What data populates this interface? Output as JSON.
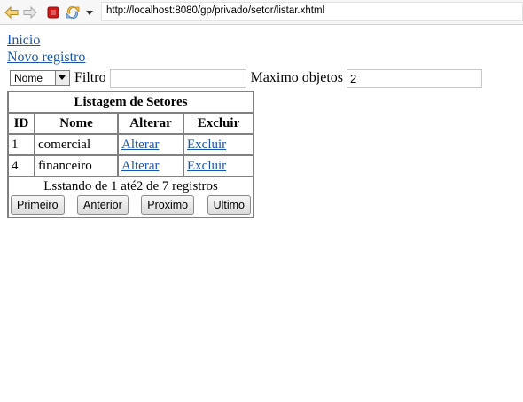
{
  "browser": {
    "url": "http://localhost:8080/gp/privado/setor/listar.xhtml",
    "icons": [
      "back-arrow-icon",
      "forward-arrow-icon",
      "stop-icon",
      "reload-icon",
      "dropdown-caret-icon"
    ]
  },
  "nav": {
    "home_link": "Inicio",
    "new_record_link": "Novo registro"
  },
  "filter": {
    "field_select_value": "Nome",
    "filter_label": "Filtro",
    "filter_value": "",
    "max_label": "Maximo objetos",
    "max_value": "2"
  },
  "table": {
    "caption": "Listagem de Setores",
    "headers": [
      "ID",
      "Nome",
      "Alterar",
      "Excluir"
    ],
    "rows": [
      {
        "id": "1",
        "nome": "comercial",
        "alterar": "Alterar",
        "excluir": "Excluir"
      },
      {
        "id": "4",
        "nome": "financeiro",
        "alterar": "Alterar",
        "excluir": "Excluir"
      }
    ],
    "status": "Lsstando de 1 até2 de 7 registros",
    "pager": [
      "Primeiro",
      "Anterior",
      "Proximo",
      "Ultimo"
    ]
  },
  "colors": {
    "link": "#1a55b0",
    "stop": "#d01818",
    "nav_arrow": "#e8b43a"
  }
}
